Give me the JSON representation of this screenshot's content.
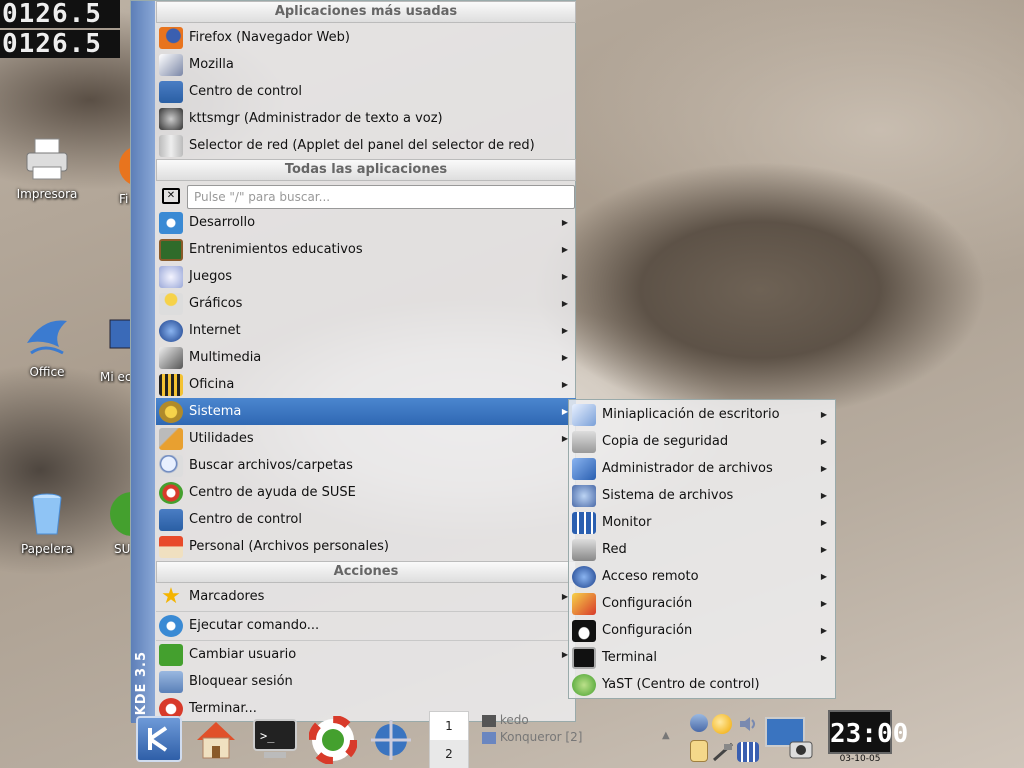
{
  "counters": [
    "0126.5",
    "0126.5"
  ],
  "desktop": {
    "icons": [
      {
        "label": "Impresora"
      },
      {
        "label": "Fi"
      },
      {
        "label": "Office"
      },
      {
        "label": "Mi ec"
      },
      {
        "label": "Papelera"
      },
      {
        "label": "SU"
      }
    ]
  },
  "menu": {
    "sidebar_label": "KDE 3.5",
    "most_used_header": "Aplicaciones más usadas",
    "most_used": [
      {
        "label": "Firefox (Navegador Web)",
        "icon": "firefox-icon"
      },
      {
        "label": "Mozilla",
        "icon": "mozilla-icon"
      },
      {
        "label": "Centro de control",
        "icon": "control-center-icon"
      },
      {
        "label": "kttsmgr (Administrador de texto a voz)",
        "icon": "tts-icon"
      },
      {
        "label": "Selector de red (Applet del panel del selector de red)",
        "icon": "network-selector-icon"
      }
    ],
    "all_apps_header": "Todas las aplicaciones",
    "search_placeholder": "Pulse \"/\" para buscar...",
    "categories": [
      {
        "label": "Desarrollo",
        "icon": "development-icon"
      },
      {
        "label": "Entrenimientos educativos",
        "icon": "education-icon"
      },
      {
        "label": "Juegos",
        "icon": "games-icon"
      },
      {
        "label": "Gráficos",
        "icon": "graphics-icon"
      },
      {
        "label": "Internet",
        "icon": "internet-icon"
      },
      {
        "label": "Multimedia",
        "icon": "multimedia-icon"
      },
      {
        "label": "Oficina",
        "icon": "office-icon"
      },
      {
        "label": "Sistema",
        "icon": "system-icon"
      },
      {
        "label": "Utilidades",
        "icon": "utilities-icon"
      }
    ],
    "extra_items": [
      {
        "label": "Buscar archivos/carpetas",
        "icon": "find-files-icon"
      },
      {
        "label": "Centro de ayuda de SUSE",
        "icon": "help-icon"
      },
      {
        "label": "Centro de control",
        "icon": "control-center-icon"
      },
      {
        "label": "Personal (Archivos personales)",
        "icon": "home-icon"
      }
    ],
    "actions_header": "Acciones",
    "actions": [
      {
        "label": "Marcadores",
        "icon": "bookmarks-icon"
      },
      {
        "label": "Ejecutar comando...",
        "icon": "run-command-icon"
      },
      {
        "label": "Cambiar usuario",
        "icon": "switch-user-icon"
      },
      {
        "label": "Bloquear sesión",
        "icon": "lock-icon"
      },
      {
        "label": "Terminar...",
        "icon": "logout-icon"
      }
    ]
  },
  "submenu": {
    "items": [
      {
        "label": "Miniaplicación de escritorio",
        "icon": "desktop-applet-icon"
      },
      {
        "label": "Copia de seguridad",
        "icon": "backup-icon"
      },
      {
        "label": "Administrador de archivos",
        "icon": "file-manager-icon"
      },
      {
        "label": "Sistema de archivos",
        "icon": "filesystem-icon"
      },
      {
        "label": "Monitor",
        "icon": "monitor-icon"
      },
      {
        "label": "Red",
        "icon": "network-icon"
      },
      {
        "label": "Acceso remoto",
        "icon": "remote-access-icon"
      },
      {
        "label": "Configuración",
        "icon": "configuration-icon"
      },
      {
        "label": "Configuración",
        "icon": "tux-icon"
      },
      {
        "label": "Terminal",
        "icon": "terminal-icon"
      },
      {
        "label": "YaST (Centro de control)",
        "icon": "yast-icon"
      }
    ]
  },
  "taskbar": {
    "pager": [
      "1",
      "2"
    ],
    "task1": "kedo",
    "task2": "Konqueror [2]",
    "clock": "23:00",
    "date": "03-10-05"
  },
  "colors": {
    "selection": "#3a74c0",
    "sidebar": "#6f90c6",
    "clock_bg": "#111111"
  }
}
